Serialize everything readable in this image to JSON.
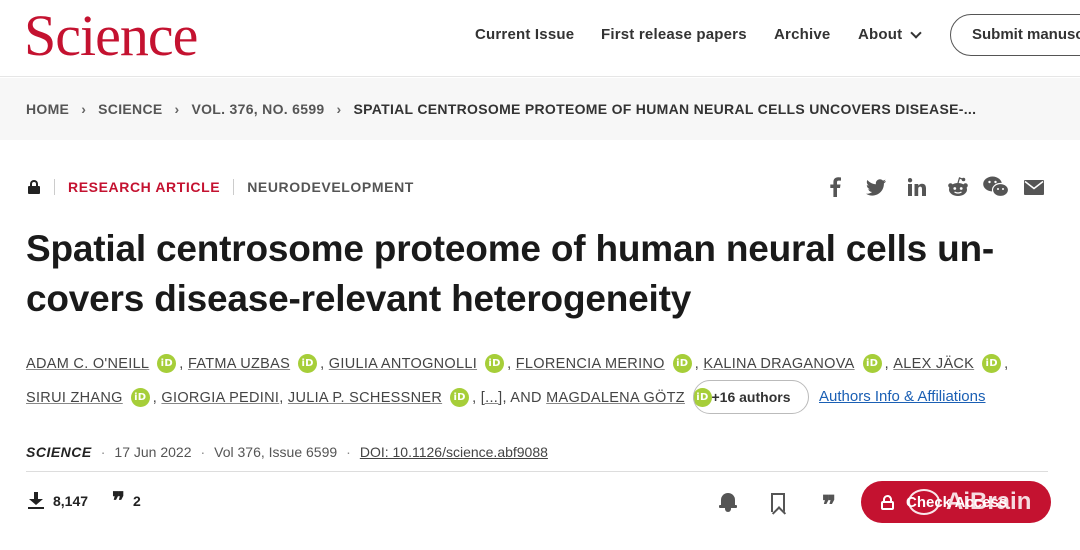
{
  "header": {
    "logo": "Science",
    "nav": {
      "current_issue": "Current Issue",
      "first_release": "First release papers",
      "archive": "Archive",
      "about": "About"
    },
    "submit_label": "Submit manuscript"
  },
  "breadcrumb": {
    "home": "HOME",
    "science": "SCIENCE",
    "volume": "VOL. 376, NO. 6599",
    "current": "SPATIAL CENTROSOME PROTEOME OF HUMAN NEURAL CELLS UNCOVERS DISEASE-..."
  },
  "article": {
    "type": "RESEARCH ARTICLE",
    "subject": "NEURODEVELOPMENT",
    "title": "Spatial centrosome proteome of human neural cells un-covers disease-relevant heterogeneity",
    "authors_line1": [
      "ADAM C. O'NEILL",
      "FATMA UZBAS",
      "GIULIA ANTOGNOLLI",
      "FLORENCIA MERINO",
      "KALINA DRAGANOVA",
      "ALEX JÄCK"
    ],
    "authors_line2": [
      "SIRUI ZHANG",
      "GIORGIA PEDINI",
      "JULIA P. SCHESSNER"
    ],
    "ellipsis": "[...]",
    "and_label": ", AND",
    "last_author": "MAGDALENA GÖTZ",
    "more_authors": "+16 authors",
    "affiliations_link": "Authors Info & Affiliations",
    "orcid_glyph": "iD",
    "journal": "SCIENCE",
    "date": "17 Jun 2022",
    "volume_issue": "Vol 376, Issue 6599",
    "doi": "DOI: 10.1126/science.abf9088"
  },
  "metrics": {
    "downloads": "8,147",
    "citations": "2"
  },
  "access_button": "Check Access",
  "watermark": "AiBrain",
  "colors": {
    "brand": "#c41230",
    "orcid": "#a6ce39",
    "link": "#1a5fb4"
  }
}
